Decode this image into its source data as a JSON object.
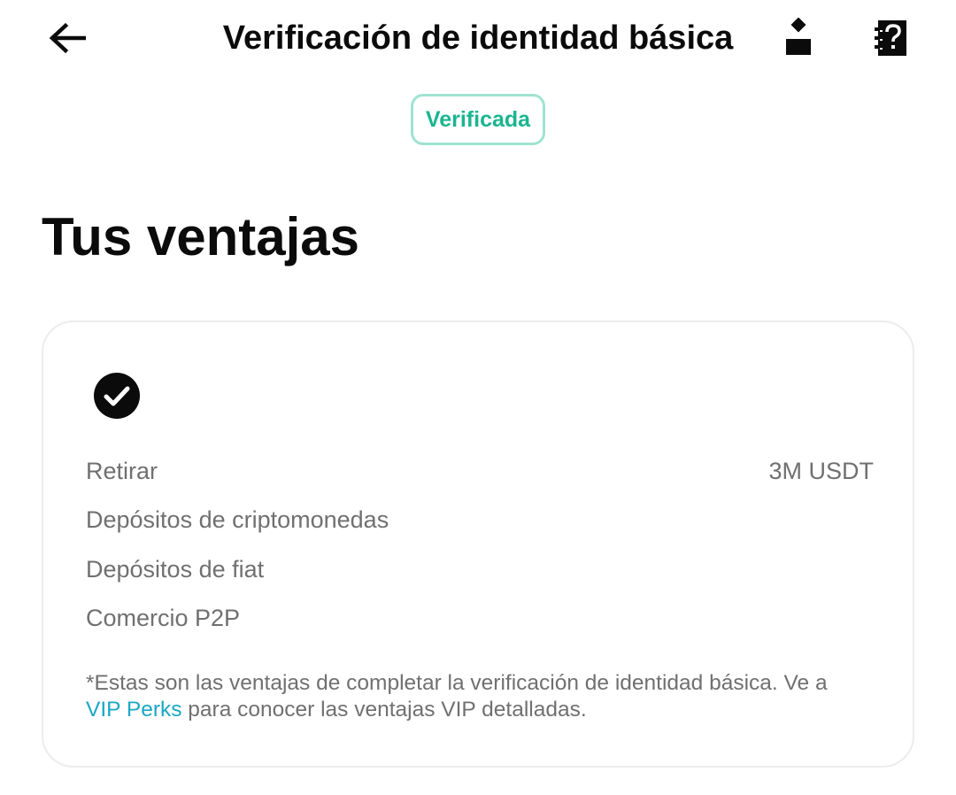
{
  "header": {
    "title": "Verificación de identidad básica",
    "back_icon": "arrow-left-icon",
    "profile_icon": "user-icon",
    "help_icon": "help-document-icon"
  },
  "status": {
    "label": "Verificada",
    "color": "#1ab590",
    "border_color": "#9fe3d1"
  },
  "benefits": {
    "title": "Tus ventajas",
    "icon": "check-circle-icon",
    "items": [
      {
        "label": "Retirar",
        "value": "3M USDT"
      },
      {
        "label": "Depósitos de criptomonedas",
        "value": ""
      },
      {
        "label": "Depósitos de fiat",
        "value": ""
      },
      {
        "label": "Comercio P2P",
        "value": ""
      }
    ],
    "note": {
      "text_before": "*Estas son las ventajas de completar la verificación de identidad básica. Ve a",
      "link": "VIP Perks",
      "text_after": " para conocer las ventajas VIP detalladas."
    }
  },
  "colors": {
    "text_primary": "#0b0b0b",
    "text_secondary": "#707070",
    "link": "#1aa8c4",
    "card_border": "#ececec"
  }
}
